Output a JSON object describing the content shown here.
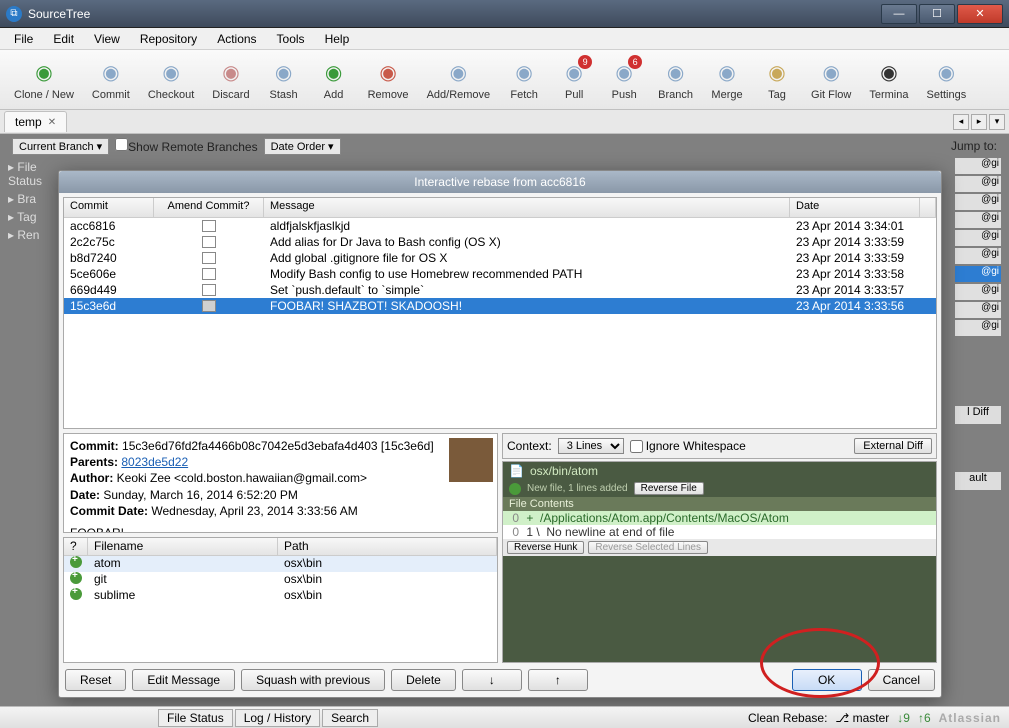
{
  "window": {
    "title": "SourceTree"
  },
  "menu": [
    "File",
    "Edit",
    "View",
    "Repository",
    "Actions",
    "Tools",
    "Help"
  ],
  "toolbar": [
    {
      "label": "Clone / New",
      "icon": "database-icon",
      "color": "#3a9a3a"
    },
    {
      "label": "Commit",
      "icon": "commit-icon",
      "color": "#8aa8c8"
    },
    {
      "label": "Checkout",
      "icon": "checkout-icon",
      "color": "#8aa8c8"
    },
    {
      "label": "Discard",
      "icon": "discard-icon",
      "color": "#c88a8a"
    },
    {
      "label": "Stash",
      "icon": "stash-icon",
      "color": "#8aa8c8"
    },
    {
      "label": "Add",
      "icon": "add-icon",
      "color": "#3a9a3a"
    },
    {
      "label": "Remove",
      "icon": "remove-icon",
      "color": "#c85a4a"
    },
    {
      "label": "Add/Remove",
      "icon": "addremove-icon",
      "color": "#8aa8c8"
    },
    {
      "label": "Fetch",
      "icon": "fetch-icon",
      "color": "#8aa8c8"
    },
    {
      "label": "Pull",
      "icon": "pull-icon",
      "color": "#8aa8c8",
      "badge": "9"
    },
    {
      "label": "Push",
      "icon": "push-icon",
      "color": "#8aa8c8",
      "badge": "6"
    },
    {
      "label": "Branch",
      "icon": "branch-icon",
      "color": "#8aa8c8"
    },
    {
      "label": "Merge",
      "icon": "merge-icon",
      "color": "#8aa8c8"
    },
    {
      "label": "Tag",
      "icon": "tag-icon",
      "color": "#c8a85a"
    },
    {
      "label": "Git Flow",
      "icon": "gitflow-icon",
      "color": "#8aa8c8"
    },
    {
      "label": "Termina",
      "icon": "terminal-icon",
      "color": "#333"
    },
    {
      "label": "Settings",
      "icon": "settings-icon",
      "color": "#8aa8c8"
    }
  ],
  "tab": {
    "name": "temp"
  },
  "back": {
    "jump_label": "Jump to:",
    "current_branch": "Current Branch ▾",
    "show_remote": "Show Remote Branches",
    "date_order": "Date Order ▾",
    "sidebar": [
      "File Status",
      "Bra",
      "Tag",
      "Ren"
    ],
    "tags": [
      "@gi",
      "@gi",
      "@gi",
      "@gi",
      "@gi",
      "@gi",
      "@gi",
      "@gi",
      "@gi",
      "@gi"
    ],
    "tag_sel_index": 6,
    "diff_lbl": "l Diff",
    "ault": "ault"
  },
  "dialog": {
    "title": "Interactive rebase from acc6816",
    "columns": {
      "commit": "Commit",
      "amend": "Amend Commit?",
      "message": "Message",
      "date": "Date"
    },
    "rows": [
      {
        "commit": "acc6816",
        "msg": "aldfjalskfjaslkjd",
        "date": "23 Apr 2014 3:34:01"
      },
      {
        "commit": "2c2c75c",
        "msg": "Add alias for Dr Java to Bash config (OS X)",
        "date": "23 Apr 2014 3:33:59"
      },
      {
        "commit": "b8d7240",
        "msg": "Add global .gitignore file for OS X",
        "date": "23 Apr 2014 3:33:59"
      },
      {
        "commit": "5ce606e",
        "msg": "Modify Bash config to use Homebrew recommended PATH",
        "date": "23 Apr 2014 3:33:58"
      },
      {
        "commit": "669d449",
        "msg": "Set `push.default` to `simple`",
        "date": "23 Apr 2014 3:33:57"
      },
      {
        "commit": "15c3e6d",
        "msg": "FOOBAR! SHAZBOT! SKADOOSH!",
        "date": "23 Apr 2014 3:33:56"
      }
    ],
    "selected": 5,
    "info": {
      "commit_lbl": "Commit:",
      "commit": "15c3e6d76fd2fa4466b08c7042e5d3ebafa4d403 [15c3e6d]",
      "parents_lbl": "Parents:",
      "parents": "8023de5d22",
      "author_lbl": "Author:",
      "author": "Keoki Zee <cold.boston.hawaiian@gmail.com>",
      "date_lbl": "Date:",
      "date": "Sunday, March 16, 2014 6:52:20 PM",
      "cdate_lbl": "Commit Date:",
      "cdate": "Wednesday, April 23, 2014 3:33:56 AM",
      "body": "FOOBAR!"
    },
    "files": {
      "cols": {
        "q": "?",
        "name": "Filename",
        "path": "Path"
      },
      "rows": [
        {
          "name": "atom",
          "path": "osx\\bin"
        },
        {
          "name": "git",
          "path": "osx\\bin"
        },
        {
          "name": "sublime",
          "path": "osx\\bin"
        }
      ],
      "selected": 0
    },
    "right": {
      "context_lbl": "Context:",
      "context": "3 Lines",
      "ignore_ws": "Ignore Whitespace",
      "external": "External Diff",
      "file_path": "osx/bin/atom",
      "file_sub": "New file, 1 lines added",
      "reverse_file": "Reverse File",
      "section": "File Contents",
      "line1_n": "0",
      "line1_s": "+",
      "line1": "/Applications/Atom.app/Contents/MacOS/Atom",
      "line2_n": "0",
      "line2_s": "1 \\",
      "line2": "No newline at end of file",
      "reverse_hunk": "Reverse Hunk",
      "reverse_sel": "Reverse Selected Lines"
    },
    "buttons": {
      "reset": "Reset",
      "edit": "Edit Message",
      "squash": "Squash with previous",
      "delete": "Delete",
      "down": "↓",
      "up": "↑",
      "ok": "OK",
      "cancel": "Cancel"
    }
  },
  "status": {
    "file_status": "File Status",
    "log": "Log / History",
    "search": "Search",
    "clean": "Clean Rebase:",
    "branch": "master",
    "up": "9",
    "down": "6",
    "atl": "Atlassian"
  }
}
